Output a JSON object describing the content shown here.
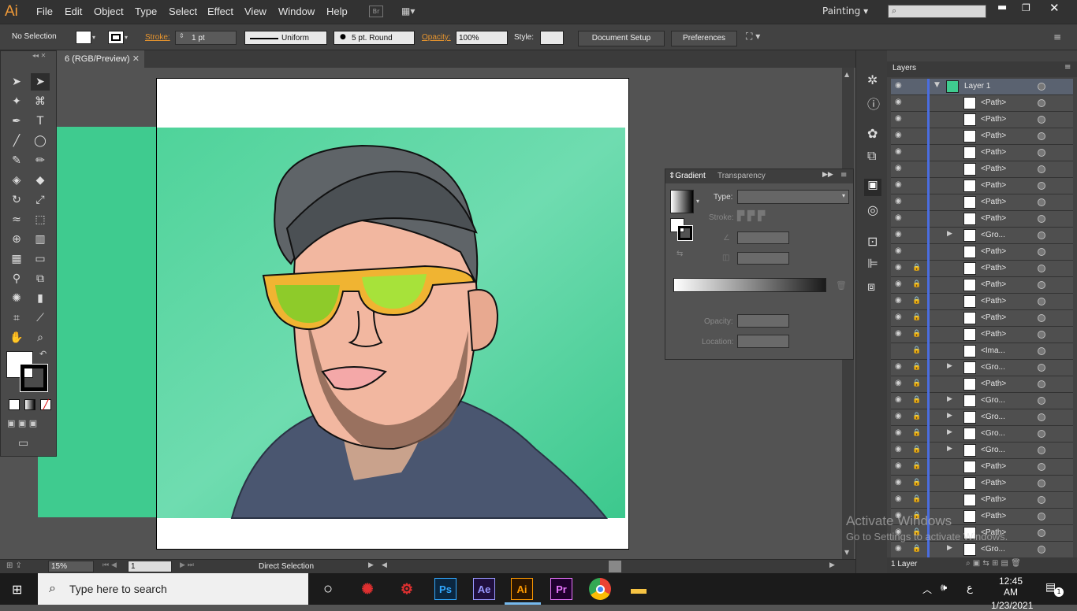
{
  "app": {
    "logo": "Ai",
    "workspace": "Painting"
  },
  "menu": [
    "File",
    "Edit",
    "Object",
    "Type",
    "Select",
    "Effect",
    "View",
    "Window",
    "Help"
  ],
  "control": {
    "selection": "No Selection",
    "stroke_label": "Stroke:",
    "stroke_weight": "1 pt",
    "profile": "Uniform",
    "brush": "5 pt. Round",
    "opacity_label": "Opacity:",
    "opacity": "100%",
    "style_label": "Style:",
    "doc_setup": "Document Setup",
    "preferences": "Preferences"
  },
  "document": {
    "tab_title": "6 (RGB/Preview)"
  },
  "status": {
    "zoom": "15%",
    "artboard": "1",
    "tool": "Direct Selection"
  },
  "gradient": {
    "tab1": "Gradient",
    "tab2": "Transparency",
    "type_label": "Type:",
    "stroke_label": "Stroke:",
    "opacity_label": "Opacity:",
    "location_label": "Location:"
  },
  "layers": {
    "title": "Layers",
    "count": "1 Layer",
    "items": [
      {
        "name": "Layer 1",
        "locked": false,
        "expand": true,
        "top": true
      },
      {
        "name": "<Path>",
        "locked": false,
        "expand": false
      },
      {
        "name": "<Path>",
        "locked": false,
        "expand": false
      },
      {
        "name": "<Path>",
        "locked": false,
        "expand": false
      },
      {
        "name": "<Path>",
        "locked": false,
        "expand": false
      },
      {
        "name": "<Path>",
        "locked": false,
        "expand": false
      },
      {
        "name": "<Path>",
        "locked": false,
        "expand": false
      },
      {
        "name": "<Path>",
        "locked": false,
        "expand": false
      },
      {
        "name": "<Path>",
        "locked": false,
        "expand": false
      },
      {
        "name": "<Gro...",
        "locked": false,
        "expand": true
      },
      {
        "name": "<Path>",
        "locked": false,
        "expand": false
      },
      {
        "name": "<Path>",
        "locked": true,
        "expand": false
      },
      {
        "name": "<Path>",
        "locked": true,
        "expand": false
      },
      {
        "name": "<Path>",
        "locked": true,
        "expand": false
      },
      {
        "name": "<Path>",
        "locked": true,
        "expand": false
      },
      {
        "name": "<Path>",
        "locked": true,
        "expand": false
      },
      {
        "name": "<Ima...",
        "locked": true,
        "expand": false,
        "hidden": true
      },
      {
        "name": "<Gro...",
        "locked": true,
        "expand": true
      },
      {
        "name": "<Path>",
        "locked": true,
        "expand": false
      },
      {
        "name": "<Gro...",
        "locked": true,
        "expand": true
      },
      {
        "name": "<Gro...",
        "locked": true,
        "expand": true
      },
      {
        "name": "<Gro...",
        "locked": true,
        "expand": true
      },
      {
        "name": "<Gro...",
        "locked": true,
        "expand": true
      },
      {
        "name": "<Path>",
        "locked": true,
        "expand": false
      },
      {
        "name": "<Path>",
        "locked": true,
        "expand": false
      },
      {
        "name": "<Path>",
        "locked": true,
        "expand": false
      },
      {
        "name": "<Path>",
        "locked": true,
        "expand": false
      },
      {
        "name": "<Path>",
        "locked": true,
        "expand": false
      },
      {
        "name": "<Gro...",
        "locked": true,
        "expand": true
      }
    ]
  },
  "watermark": {
    "line1": "Activate Windows",
    "line2": "Go to Settings to activate Windows."
  },
  "taskbar": {
    "search": "Type here to search",
    "time": "12:45 AM",
    "date": "1/23/2021",
    "lang": "ع",
    "notif": "1"
  },
  "colors": {
    "accent": "#f29b38",
    "background": "#3fcb8f",
    "glasses": "#f0b432",
    "lens": "#8ed12e"
  }
}
